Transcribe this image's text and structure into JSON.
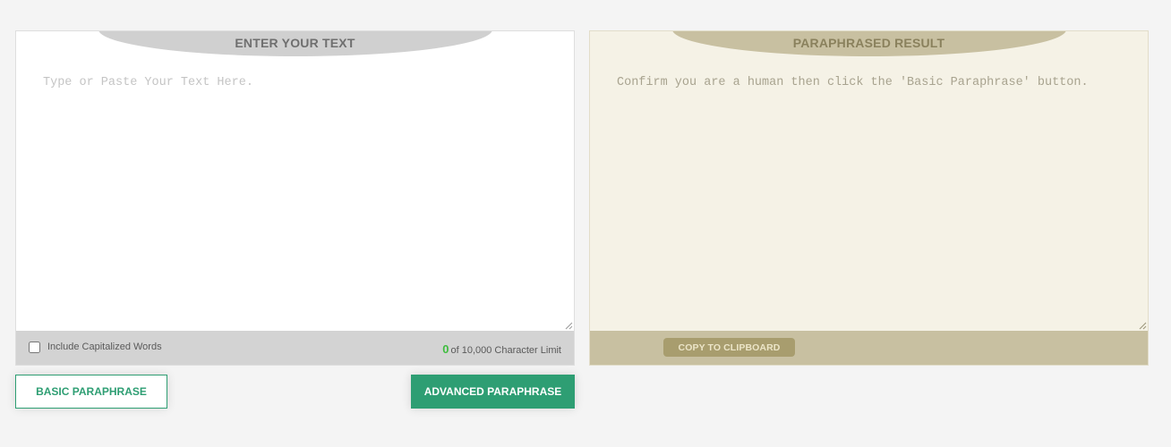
{
  "input_panel": {
    "title": "ENTER YOUR TEXT",
    "placeholder": "Type or Paste Your Text Here.",
    "value": "",
    "include_capitalized_label": "Include Capitalized Words",
    "include_capitalized_checked": false,
    "char_count": "0",
    "char_limit_text": "of 10,000 Character Limit",
    "count_color": "#3ebd3e"
  },
  "result_panel": {
    "title": "PARAPHRASED RESULT",
    "message": "Confirm you are a human then click the 'Basic Paraphrase' button.",
    "copy_label": "COPY TO CLIPBOARD"
  },
  "actions": {
    "basic_label": "BASIC PARAPHRASE",
    "advanced_label": "ADVANCED PARAPHRASE",
    "accent_color": "#2e9e73"
  }
}
